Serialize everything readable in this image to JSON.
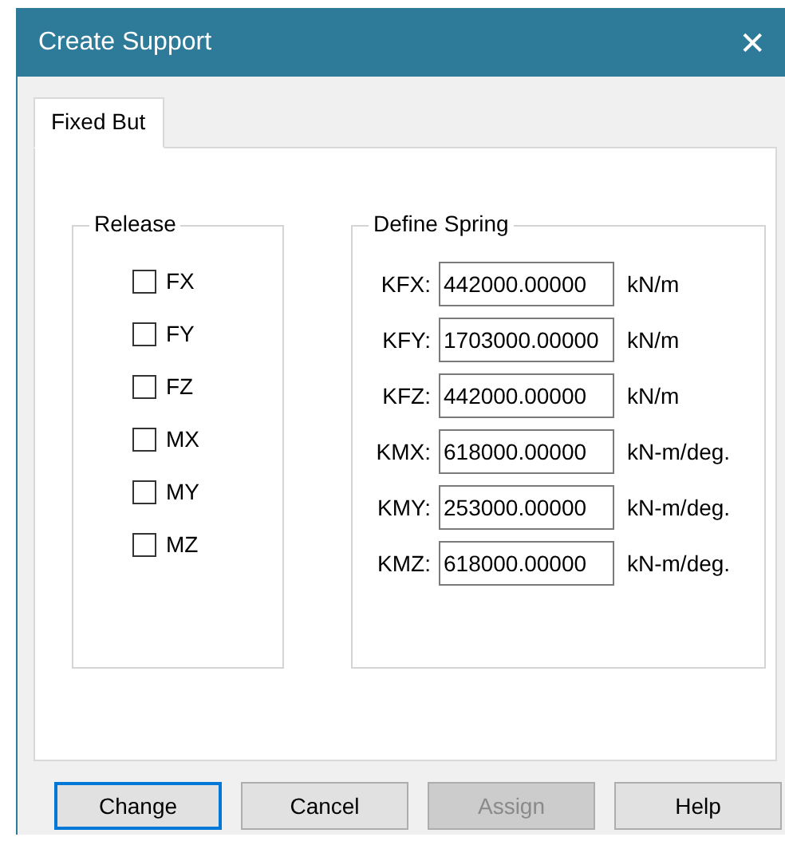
{
  "window": {
    "title": "Create Support",
    "close": "✕"
  },
  "tabs": [
    {
      "label": "Fixed But",
      "selected": true
    }
  ],
  "release": {
    "title": "Release",
    "items": [
      {
        "label": "FX",
        "checked": false
      },
      {
        "label": "FY",
        "checked": false
      },
      {
        "label": "FZ",
        "checked": false
      },
      {
        "label": "MX",
        "checked": false
      },
      {
        "label": "MY",
        "checked": false
      },
      {
        "label": "MZ",
        "checked": false
      }
    ]
  },
  "define_spring": {
    "title": "Define Spring",
    "rows": [
      {
        "label": "KFX:",
        "value": "442000.00000",
        "unit": "kN/m"
      },
      {
        "label": "KFY:",
        "value": "1703000.00000",
        "unit": "kN/m"
      },
      {
        "label": "KFZ:",
        "value": "442000.00000",
        "unit": "kN/m"
      },
      {
        "label": "KMX:",
        "value": "618000.00000",
        "unit": "kN-m/deg."
      },
      {
        "label": "KMY:",
        "value": "253000.00000",
        "unit": "kN-m/deg."
      },
      {
        "label": "KMZ:",
        "value": "618000.00000",
        "unit": "kN-m/deg."
      }
    ]
  },
  "buttons": [
    {
      "label": "Change",
      "focused": true,
      "disabled": false
    },
    {
      "label": "Cancel",
      "focused": false,
      "disabled": false
    },
    {
      "label": "Assign",
      "focused": false,
      "disabled": true
    },
    {
      "label": "Help",
      "focused": false,
      "disabled": false
    }
  ]
}
